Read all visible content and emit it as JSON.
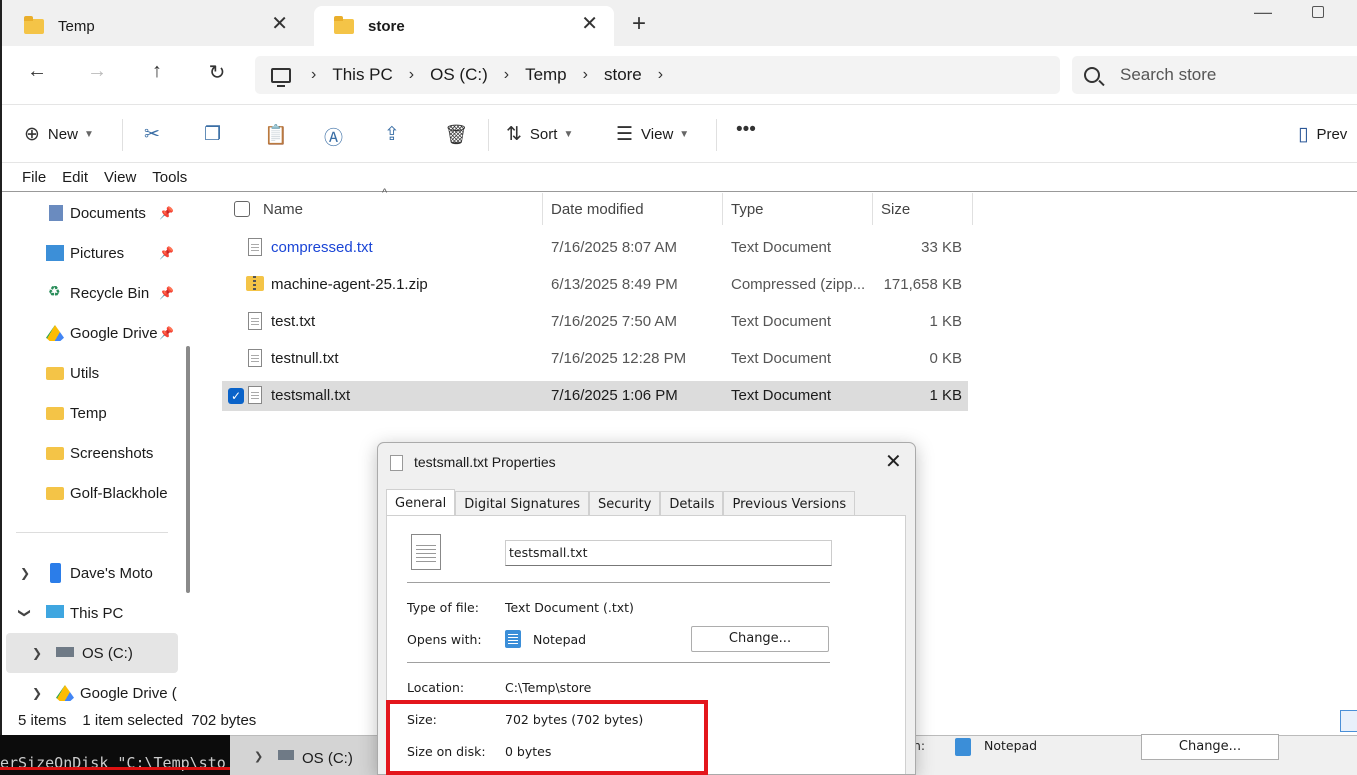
{
  "tabs": [
    {
      "label": "Temp"
    },
    {
      "label": "store"
    }
  ],
  "breadcrumb": [
    "This PC",
    "OS (C:)",
    "Temp",
    "store"
  ],
  "search": {
    "placeholder": "Search store"
  },
  "toolbar": {
    "new_label": "New",
    "sort_label": "Sort",
    "view_label": "View",
    "preview_label": "Prev"
  },
  "menu": [
    "File",
    "Edit",
    "View",
    "Tools"
  ],
  "nav": {
    "items": [
      {
        "label": "Documents",
        "icon": "documents-icon",
        "pinned": true
      },
      {
        "label": "Pictures",
        "icon": "pictures-icon",
        "pinned": true
      },
      {
        "label": "Recycle Bin",
        "icon": "recycle-bin-icon",
        "pinned": true
      },
      {
        "label": "Google Drive",
        "icon": "google-drive-icon",
        "pinned": true
      },
      {
        "label": "Utils",
        "icon": "folder-icon",
        "pinned": false
      },
      {
        "label": "Temp",
        "icon": "folder-icon",
        "pinned": false
      },
      {
        "label": "Screenshots",
        "icon": "folder-icon",
        "pinned": false
      },
      {
        "label": "Golf-Blackhole",
        "icon": "folder-icon",
        "pinned": false
      }
    ],
    "tree": [
      {
        "label": "Dave's Moto",
        "icon": "phone-icon"
      },
      {
        "label": "This PC",
        "icon": "monitor-icon"
      },
      {
        "label": "OS (C:)",
        "icon": "drive-icon"
      },
      {
        "label": "Google Drive (",
        "icon": "google-drive-icon"
      }
    ]
  },
  "columns": {
    "name": "Name",
    "date": "Date modified",
    "type": "Type",
    "size": "Size"
  },
  "files": [
    {
      "name": "compressed.txt",
      "date": "7/16/2025 8:07 AM",
      "type": "Text Document",
      "size": "33 KB"
    },
    {
      "name": "machine-agent-25.1.zip",
      "date": "6/13/2025 8:49 PM",
      "type": "Compressed (zipp...",
      "size": "171,658 KB"
    },
    {
      "name": "test.txt",
      "date": "7/16/2025 7:50 AM",
      "type": "Text Document",
      "size": "1 KB"
    },
    {
      "name": "testnull.txt",
      "date": "7/16/2025 12:28 PM",
      "type": "Text Document",
      "size": "0 KB"
    },
    {
      "name": "testsmall.txt",
      "date": "7/16/2025 1:06 PM",
      "type": "Text Document",
      "size": "1 KB"
    }
  ],
  "status": {
    "count": "5 items",
    "selected": "1 item selected",
    "bytes": "702 bytes"
  },
  "terminal": {
    "text": "erSizeOnDisk \"C:\\Temp\\sto"
  },
  "background_window": {
    "drive": "OS (C:)",
    "opens_label": "n:",
    "app": "Notepad",
    "change": "Change..."
  },
  "dialog": {
    "title": "testsmall.txt Properties",
    "tabs": [
      "General",
      "Digital Signatures",
      "Security",
      "Details",
      "Previous Versions"
    ],
    "filename": "testsmall.txt",
    "type_label": "Type of file:",
    "type_value": "Text Document (.txt)",
    "opens_label": "Opens with:",
    "opens_value": "Notepad",
    "change_label": "Change...",
    "location_label": "Location:",
    "location_value": "C:\\Temp\\store",
    "size_label": "Size:",
    "size_value": "702 bytes (702 bytes)",
    "disk_label": "Size on disk:",
    "disk_value": "0 bytes"
  },
  "colors": {
    "accent": "#0a63c9",
    "highlight": "#e3161c",
    "folder": "#f4c447"
  }
}
